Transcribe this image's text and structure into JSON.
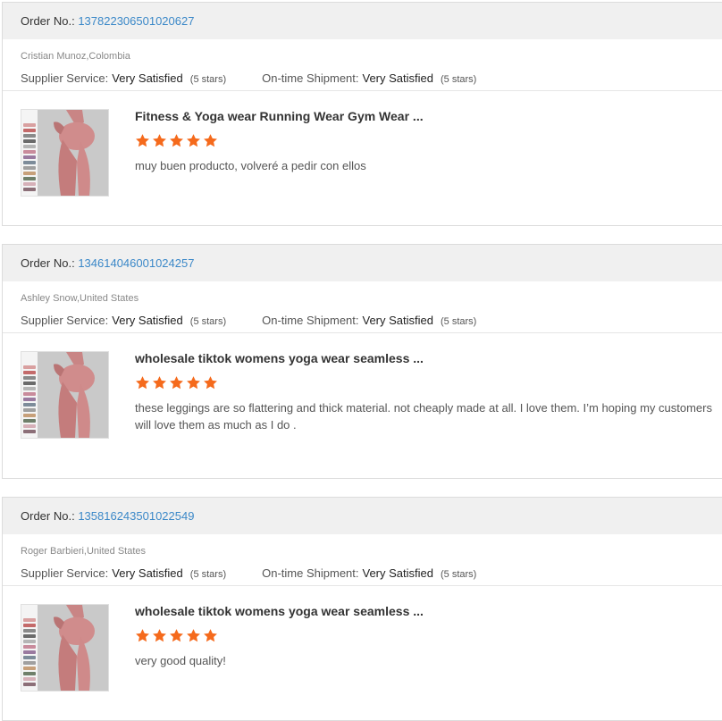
{
  "order_label": "Order No.:",
  "supplier_label": "Supplier Service:",
  "shipment_label": "On-time Shipment:",
  "colors": {
    "star": "#f56a1c",
    "link": "#3b88c8",
    "header_bg": "#f0f0f0"
  },
  "reviews": [
    {
      "order_no": "137822306501020627",
      "buyer": "Cristian Munoz,Colombia",
      "supplier_rating": "Very Satisfied",
      "supplier_stars": "(5 stars)",
      "shipment_rating": "Very Satisfied",
      "shipment_stars": "(5 stars)",
      "product_title": "Fitness & Yoga wear Running Wear Gym Wear ...",
      "stars": 5,
      "review_text": "muy buen producto, volveré a pedir con ellos"
    },
    {
      "order_no": "134614046001024257",
      "buyer": "Ashley Snow,United States",
      "supplier_rating": "Very Satisfied",
      "supplier_stars": "(5 stars)",
      "shipment_rating": "Very Satisfied",
      "shipment_stars": "(5 stars)",
      "product_title": "wholesale tiktok womens yoga wear seamless ...",
      "stars": 5,
      "review_text": "these leggings are so flattering and thick material. not cheaply made at all. I love them. I’m hoping my customers will love them as much as I do ."
    },
    {
      "order_no": "135816243501022549",
      "buyer": "Roger Barbieri,United States",
      "supplier_rating": "Very Satisfied",
      "supplier_stars": "(5 stars)",
      "shipment_rating": "Very Satisfied",
      "shipment_stars": "(5 stars)",
      "product_title": "wholesale tiktok womens yoga wear seamless ...",
      "stars": 5,
      "review_text": "very good quality!"
    }
  ]
}
